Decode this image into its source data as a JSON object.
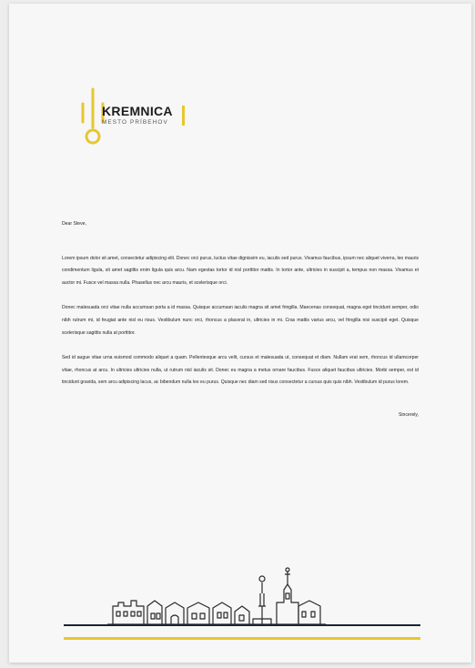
{
  "brand": {
    "name": "KREMNICA",
    "tagline": "MESTO PRÍBEHOV",
    "accent_color": "#e8c630",
    "dark_color": "#1b2330"
  },
  "letter": {
    "salutation": "Dear Steve,",
    "paragraphs": [
      "Lorem ipsum dolor sit amet, consectetur adipiscing elit. Donec orci purus, luctus vitae dignissim eu, iaculis sed purus. Vivamus faucibus, ipsum nec aliquet viverra, leo mauris condimentum ligula, sit amet sagittis enim ligula quis arcu. Nam egestas tortor id nisl porttitor mattis. In tortor ante, ultricies in suscipit a, tempus non massa. Vivamus et auctor mi. Fusce vel massa nulla. Phasellus nec arcu mauris, et scelerisque orci.",
      "Donec malesuada orci vitae nulla accumsan porta a id massa. Quisque accumsan iaculis magna sit amet fringilla. Maecenas consequat, magna eget tincidunt semper, odio nibh rutrum mi, id feugiat ante nisl eu risus. Vestibulum nunc orci, rhoncus a placerat in, ultricies in mi. Cras mattis varius arcu, vel fringilla nisi suscipit eget. Quisque scelerisque sagittis nulla at porttitor.",
      "Sed id augue vitae urna euismod commodo aliquet a quam. Pellentesque arcu velit, cursus et malesuada ut, consequat et diam. Nullam erat sem, rhoncus id ullamcorper vitae, rhoncus at arcu. In ultricies ultricies nulla, ut rutrum nisl iaculis sit. Donec eu magna a metus ornare faucibus. Fusce aliquet faucibus ultricies. Morbi semper, est id tincidunt gravida, sem arcu adipiscing lacus, ac bibendum nulla leo eu purus. Quisque nec diam sed risus consectetur a cursus quis quis nibh. Vestibulum id purus lorem."
    ],
    "closing": "Sincerely,"
  }
}
